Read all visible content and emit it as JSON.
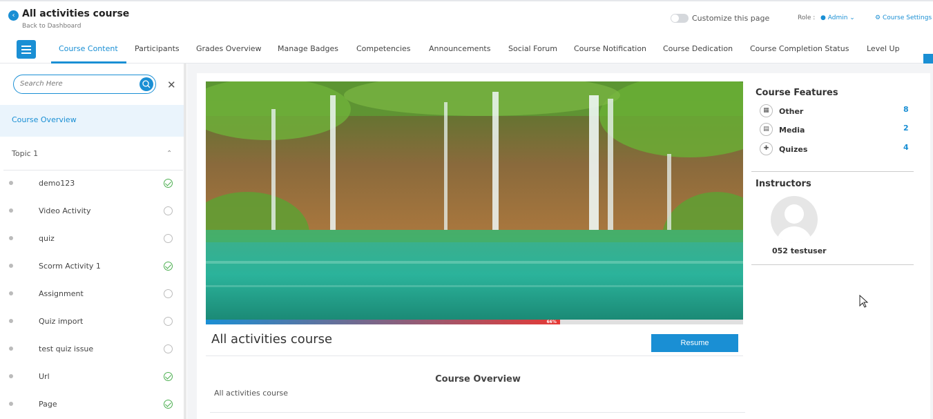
{
  "header": {
    "course_title": "All activities course",
    "back_link": "Back to Dashboard",
    "customize_label": "Customize this page",
    "role_label": "Role :",
    "role_value": "Admin",
    "settings_label": "Course Settings"
  },
  "nav": {
    "tabs": [
      {
        "label": "Course Content",
        "active": true
      },
      {
        "label": "Participants"
      },
      {
        "label": "Grades Overview"
      },
      {
        "label": "Manage Badges"
      },
      {
        "label": "Competencies"
      },
      {
        "label": "Announcements"
      },
      {
        "label": "Social Forum"
      },
      {
        "label": "Course Notification"
      },
      {
        "label": "Course Dedication"
      },
      {
        "label": "Course Completion Status"
      },
      {
        "label": "Level Up"
      }
    ]
  },
  "sidebar": {
    "search_placeholder": "Search Here",
    "overview_label": "Course Overview",
    "topic_label": "Topic 1",
    "activities": [
      {
        "name": "demo123",
        "completed": true
      },
      {
        "name": "Video Activity",
        "completed": false
      },
      {
        "name": "quiz",
        "completed": false
      },
      {
        "name": "Scorm Activity 1",
        "completed": true
      },
      {
        "name": "Assignment",
        "completed": false
      },
      {
        "name": "Quiz import",
        "completed": false
      },
      {
        "name": "test quiz issue",
        "completed": false
      },
      {
        "name": "Url",
        "completed": true
      },
      {
        "name": "Page",
        "completed": true
      }
    ]
  },
  "main": {
    "progress_percent": 66,
    "progress_label": "66%",
    "title": "All activities course",
    "resume_label": "Resume",
    "overview_heading": "Course Overview",
    "overview_text": "All activities course"
  },
  "features": {
    "title": "Course Features",
    "items": [
      {
        "label": "Other",
        "count": "8",
        "icon": "calendar-icon"
      },
      {
        "label": "Media",
        "count": "2",
        "icon": "document-icon"
      },
      {
        "label": "Quizes",
        "count": "4",
        "icon": "puzzle-icon"
      }
    ]
  },
  "instructors": {
    "title": "Instructors",
    "name": "052 testuser"
  },
  "colors": {
    "accent": "#1a8fd4",
    "success": "#4caf50",
    "progress_end": "#e53935"
  }
}
